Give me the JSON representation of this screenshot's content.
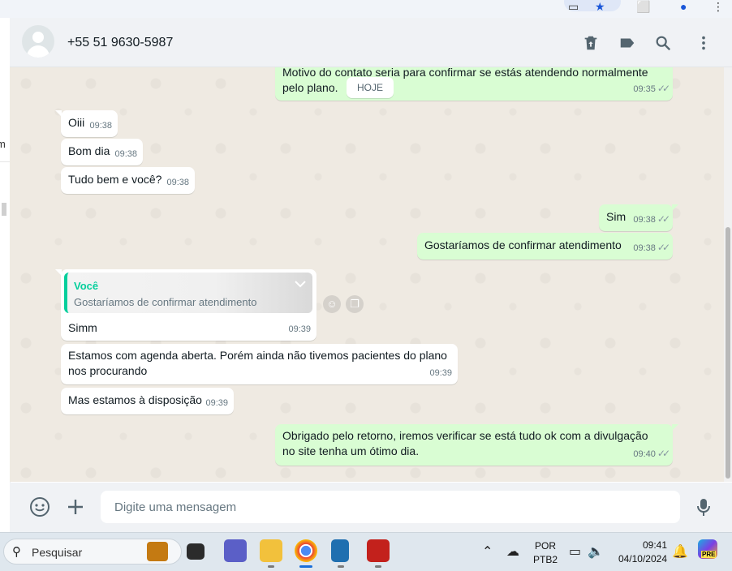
{
  "browser": {
    "icons": [
      "monitor-icon",
      "star-icon",
      "share-icon",
      "profile-icon",
      "more-icon"
    ]
  },
  "left_panel": {
    "fragment": "m"
  },
  "header": {
    "contact_name": "+55 51 9630-5987",
    "icons": [
      "archive-icon",
      "label-icon",
      "search-icon",
      "menu-icon"
    ]
  },
  "chat": {
    "date_chip": "HOJE",
    "messages": [
      {
        "dir": "out",
        "text_lines": [
          "Motivo do contato seria para confirmar se estás atendendo normalmente",
          "pelo plano."
        ],
        "time": "09:35",
        "status": "read"
      },
      {
        "dir": "in",
        "text": "Oiii",
        "time": "09:38"
      },
      {
        "dir": "in",
        "text": "Bom dia",
        "time": "09:38"
      },
      {
        "dir": "in",
        "text": "Tudo bem e você?",
        "time": "09:38"
      },
      {
        "dir": "out",
        "text": "Sim",
        "time": "09:38",
        "status": "read"
      },
      {
        "dir": "out",
        "text": "Gostaríamos de confirmar atendimento",
        "time": "09:38",
        "status": "read"
      },
      {
        "dir": "in",
        "quote": {
          "author": "Você",
          "text": "Gostaríamos de confirmar atendimento"
        },
        "text": "Simm",
        "time": "09:39"
      },
      {
        "dir": "in",
        "text_lines": [
          "Estamos com agenda aberta. Porém ainda não tivemos pacientes do plano",
          "nos procurando"
        ],
        "time": "09:39"
      },
      {
        "dir": "in",
        "text": "Mas estamos à disposição",
        "time": "09:39"
      },
      {
        "dir": "out",
        "text_lines": [
          "Obrigado pelo retorno, iremos verificar se está tudo ok com a divulgação",
          "no site tenha um ótimo dia."
        ],
        "time": "09:40",
        "status": "read"
      }
    ],
    "read_check": "✓✓"
  },
  "composer": {
    "placeholder": "Digite uma mensagem",
    "icons": [
      "emoji-icon",
      "plus-icon",
      "mic-icon"
    ]
  },
  "taskbar": {
    "search_placeholder": "Pesquisar",
    "language": "POR",
    "layout": "PTB2",
    "clock_time": "09:41",
    "clock_date": "04/10/2024",
    "copilot_badge": "PRE"
  },
  "colors": {
    "outgoing": "#d9fdd3",
    "incoming": "#ffffff",
    "chat_bg": "#efeae2",
    "quote_accent": "#06cf9c",
    "header_bg": "#f0f2f5"
  }
}
